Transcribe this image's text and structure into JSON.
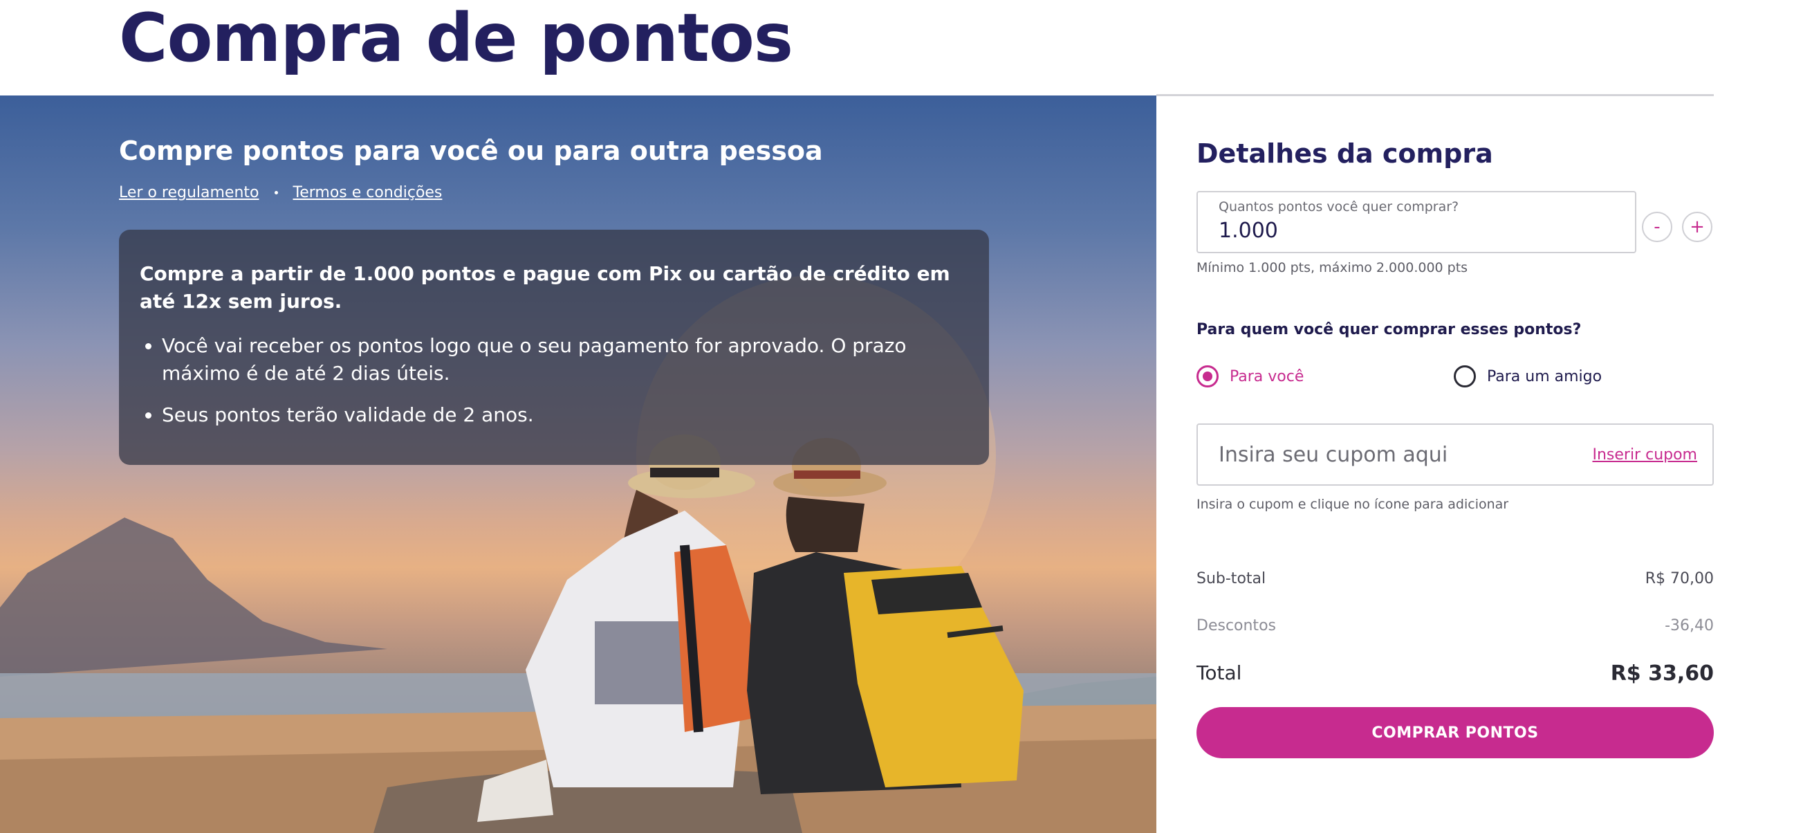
{
  "page": {
    "title": "Compra de pontos"
  },
  "hero": {
    "heading": "Compre pontos para você ou para outra pessoa",
    "links": {
      "rules": "Ler o regulamento",
      "terms": "Termos e condições"
    },
    "info": {
      "lead": "Compre a partir de 1.000 pontos e pague com Pix ou cartão de crédito em até 12x sem juros.",
      "bullets": [
        "Você vai receber os pontos logo que o seu pagamento for aprovado. O prazo máximo é de até 2 dias úteis.",
        "Seus pontos terão validade de 2 anos."
      ]
    }
  },
  "purchase": {
    "title": "Detalhes da compra",
    "points": {
      "label": "Quantos pontos você quer comprar?",
      "value": "1.000",
      "hint": "Mínimo 1.000 pts, máximo 2.000.000 pts",
      "decrement": "-",
      "increment": "+"
    },
    "recipient": {
      "question": "Para quem você quer comprar esses pontos?",
      "options": [
        {
          "label": "Para você",
          "selected": true
        },
        {
          "label": "Para um amigo",
          "selected": false
        }
      ]
    },
    "coupon": {
      "placeholder": "Insira seu cupom aqui",
      "action": "Inserir cupom",
      "hint": "Insira o cupom e clique no ícone para adicionar"
    },
    "summary": {
      "subtotal_label": "Sub-total",
      "subtotal_value": "R$ 70,00",
      "discount_label": "Descontos",
      "discount_value": "-36,40",
      "total_label": "Total",
      "total_value": "R$ 33,60"
    },
    "buy_label": "COMPRAR PONTOS"
  },
  "colors": {
    "brand": "#c72b8f",
    "title": "#23205f"
  }
}
